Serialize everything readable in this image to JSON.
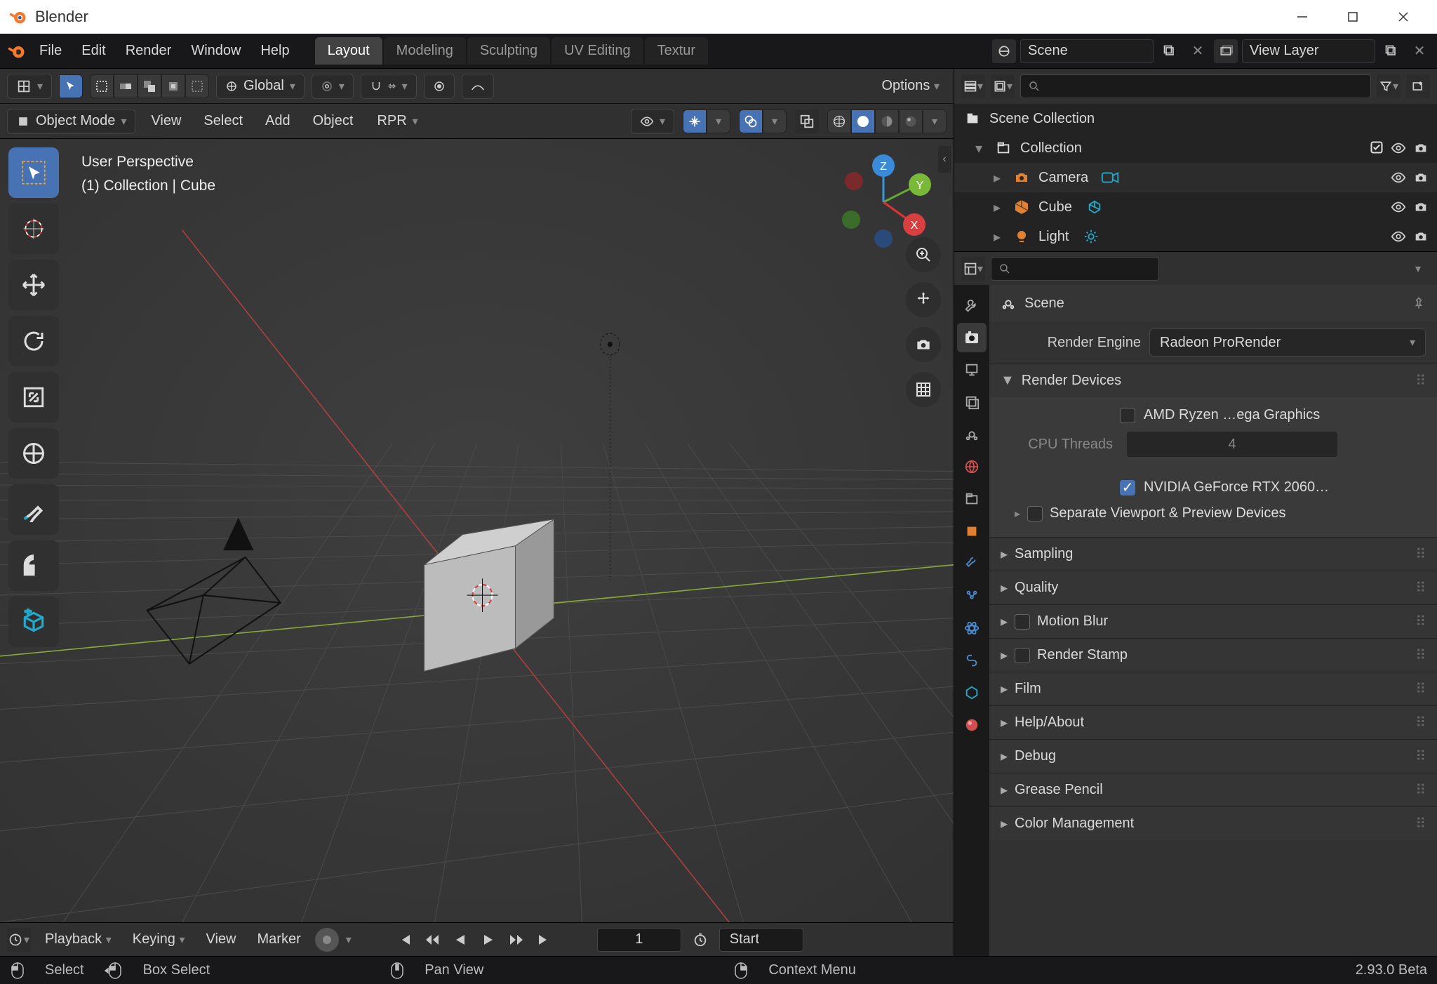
{
  "window": {
    "title": "Blender"
  },
  "menus": [
    "File",
    "Edit",
    "Render",
    "Window",
    "Help"
  ],
  "workspaces": [
    "Layout",
    "Modeling",
    "Sculpting",
    "UV Editing",
    "Textur"
  ],
  "active_workspace": "Layout",
  "scene_name": "Scene",
  "view_layer": "View Layer",
  "viewport_header": {
    "orientation": "Global",
    "options_label": "Options",
    "mode": "Object Mode",
    "submenus": [
      "View",
      "Select",
      "Add",
      "Object",
      "RPR"
    ]
  },
  "viewport_info": {
    "line1": "User Perspective",
    "line2": "(1) Collection | Cube"
  },
  "outliner": {
    "root": "Scene Collection",
    "collection": "Collection",
    "items": [
      "Camera",
      "Cube",
      "Light"
    ]
  },
  "properties": {
    "crumb": "Scene",
    "render_engine_label": "Render Engine",
    "render_engine_value": "Radeon ProRender",
    "panels": {
      "render_devices": "Render Devices",
      "devices": {
        "cpu_label": "AMD Ryzen …ega Graphics",
        "cpu_threads_label": "CPU Threads",
        "cpu_threads_value": "4",
        "gpu_label": "NVIDIA GeForce RTX 2060…",
        "separate_viewport": "Separate Viewport & Preview Devices"
      },
      "rest": [
        "Sampling",
        "Quality",
        "Motion Blur",
        "Render Stamp",
        "Film",
        "Help/About",
        "Debug",
        "Grease Pencil",
        "Color Management"
      ]
    }
  },
  "timeline": {
    "menus": [
      "Playback",
      "Keying",
      "View",
      "Marker"
    ],
    "frame": "1",
    "start_label": "Start"
  },
  "status": {
    "select": "Select",
    "box_select": "Box Select",
    "pan": "Pan View",
    "context": "Context Menu",
    "version": "2.93.0 Beta"
  }
}
